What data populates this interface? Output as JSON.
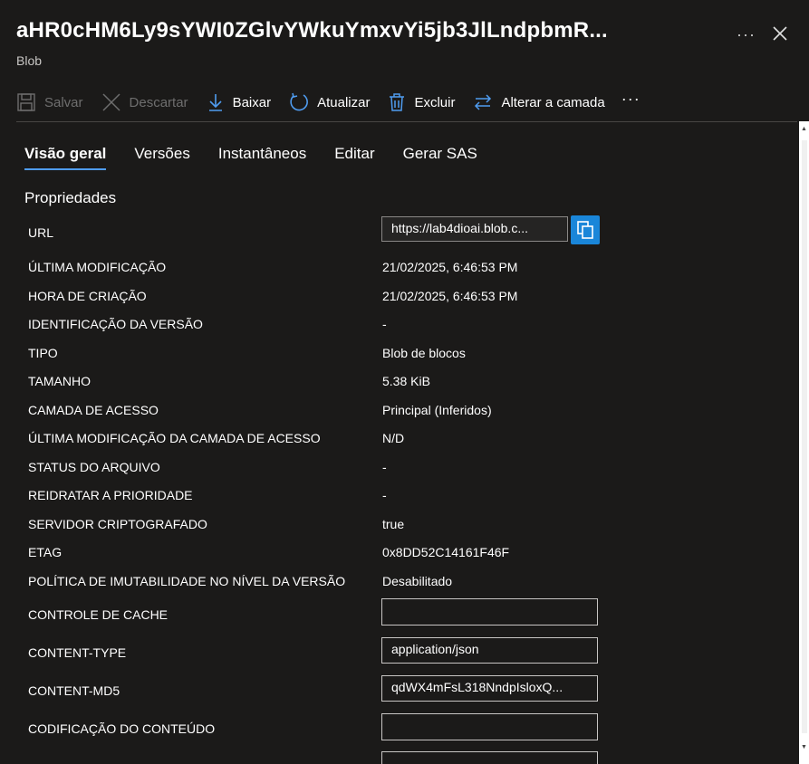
{
  "header": {
    "title": "aHR0cHM6Ly9sYWI0ZGlvYWkuYmxvYi5jb3JlLndpbmR...",
    "subtitle": "Blob",
    "more": "···"
  },
  "toolbar": {
    "save": "Salvar",
    "discard": "Descartar",
    "download": "Baixar",
    "refresh": "Atualizar",
    "delete": "Excluir",
    "change_tier": "Alterar a camada",
    "more": "···"
  },
  "tabs": [
    "Visão geral",
    "Versões",
    "Instantâneos",
    "Editar",
    "Gerar SAS"
  ],
  "section_title": "Propriedades",
  "properties": [
    {
      "label": "URL",
      "value": "https://lab4dioai.blob.c..."
    },
    {
      "label": "ÚLTIMA MODIFICAÇÃO",
      "value": "21/02/2025, 6:46:53 PM"
    },
    {
      "label": "HORA DE CRIAÇÃO",
      "value": "21/02/2025, 6:46:53 PM"
    },
    {
      "label": "IDENTIFICAÇÃO DA VERSÃO",
      "value": "-"
    },
    {
      "label": "TIPO",
      "value": "Blob de blocos"
    },
    {
      "label": "TAMANHO",
      "value": "5.38 KiB"
    },
    {
      "label": "CAMADA DE ACESSO",
      "value": "Principal (Inferidos)"
    },
    {
      "label": "ÚLTIMA MODIFICAÇÃO DA CAMADA DE ACESSO",
      "value": "N/D"
    },
    {
      "label": "STATUS DO ARQUIVO",
      "value": "-"
    },
    {
      "label": "REIDRATAR A PRIORIDADE",
      "value": "-"
    },
    {
      "label": "SERVIDOR CRIPTOGRAFADO",
      "value": "true"
    },
    {
      "label": "ETAG",
      "value": "0x8DD52C14161F46F"
    },
    {
      "label": "POLÍTICA DE IMUTABILIDADE NO NÍVEL DA VERSÃO",
      "value": "Desabilitado"
    }
  ],
  "editable": [
    {
      "label": "CONTROLE DE CACHE",
      "value": ""
    },
    {
      "label": "CONTENT-TYPE",
      "value": "application/json"
    },
    {
      "label": "CONTENT-MD5",
      "value": "qdWX4mFsL318NndpIsloxQ..."
    },
    {
      "label": "CODIFICAÇÃO DO CONTEÚDO",
      "value": ""
    }
  ],
  "colors": {
    "accent": "#4f9cf0",
    "copy_button": "#1a86d9",
    "background": "#1b1a19"
  },
  "icons": [
    "save-icon",
    "discard-icon",
    "download-icon",
    "refresh-icon",
    "delete-icon",
    "swap-icon",
    "copy-icon",
    "close-icon"
  ]
}
